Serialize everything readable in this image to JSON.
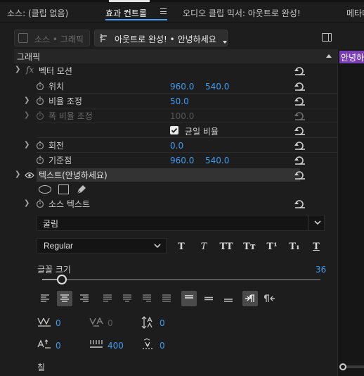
{
  "tabs": {
    "source": "소스: (클립 없음)",
    "effect_controls": "효과 컨트롤",
    "menu_icon": "hamburger-icon",
    "audio_mixer": "오디오 클립 믹서: 아웃트로 완성!",
    "metadata": "메타데"
  },
  "clipbar": {
    "source_clip": "소스 • 그래픽",
    "sequence_clip": "아웃트로 완성! • 안녕하세요"
  },
  "section": {
    "graphics": "그래픽",
    "timeline_clip": "안녕하"
  },
  "vector_motion": {
    "fx": "fx",
    "label": "벡터 모션",
    "position_label": "위치",
    "position_x": "960.0",
    "position_y": "540.0",
    "scale_label": "비율 조정",
    "scale_value": "50.0",
    "width_label": "폭 비율 조정",
    "width_value": "100.0",
    "uniform_label": "균일 비율",
    "uniform_checked": true,
    "rotation_label": "회전",
    "rotation_value": "0.0",
    "anchor_label": "기준점",
    "anchor_x": "960.0",
    "anchor_y": "540.0"
  },
  "text_layer": {
    "label": "텍스트(안녕하세요)",
    "source_text_label": "소스 텍스트",
    "font_family": "굴림",
    "font_style": "Regular",
    "font_size_label": "글꼴 크기",
    "font_size_value": "36",
    "font_size_slider_fraction": 0.07,
    "kerning_value": "0",
    "tracking_value": "0",
    "leading_value": "0",
    "baseline_value": "0",
    "tsume_value": "400",
    "indent_value": "0",
    "fill_label": "칠"
  },
  "style_buttons": [
    "T",
    "T",
    "TT",
    "Tт",
    "T¹",
    "T₁",
    "T"
  ],
  "colors": {
    "accent_blue": "#3f9bf0",
    "panel_bg": "#1d1d1d",
    "clip_purple": "#7a3fb5"
  }
}
